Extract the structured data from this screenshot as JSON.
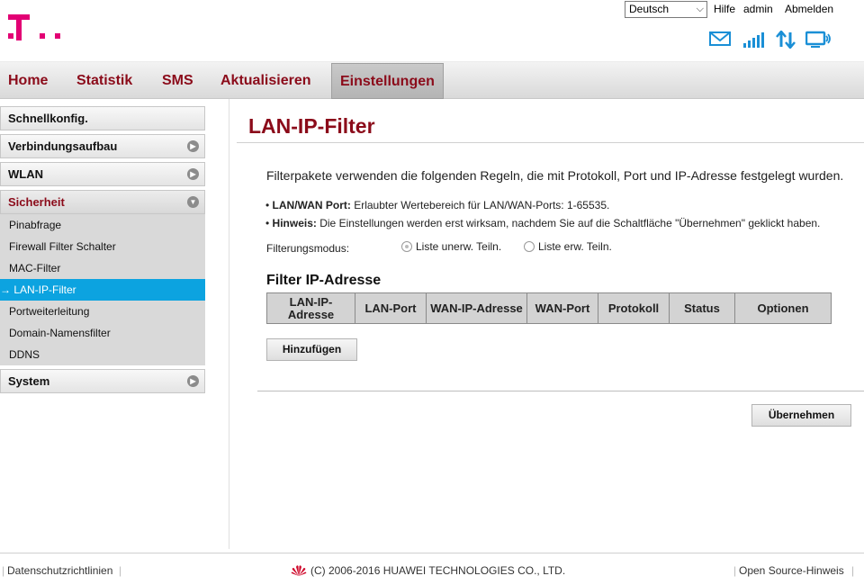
{
  "header": {
    "language": "Deutsch",
    "links": {
      "help": "Hilfe",
      "admin": "admin",
      "logout": "Abmelden"
    },
    "brand_color": "#e20074"
  },
  "nav": {
    "items": [
      {
        "label": "Home"
      },
      {
        "label": "Statistik"
      },
      {
        "label": "SMS"
      },
      {
        "label": "Aktualisieren"
      },
      {
        "label": "Einstellungen",
        "active": true
      }
    ],
    "accent_color": "#8b0b1a"
  },
  "sidebar": {
    "groups": [
      {
        "label": "Schnellkonfig."
      },
      {
        "label": "Verbindungsaufbau"
      },
      {
        "label": "WLAN"
      },
      {
        "label": "Sicherheit",
        "open": true
      },
      {
        "label": "System"
      }
    ],
    "sub_items": [
      {
        "label": "Pinabfrage"
      },
      {
        "label": "Firewall Filter Schalter"
      },
      {
        "label": "MAC-Filter"
      },
      {
        "label": "→ LAN-IP-Filter",
        "active": true
      },
      {
        "label": "Portweiterleitung"
      },
      {
        "label": "Domain-Namensfilter"
      },
      {
        "label": "DDNS"
      }
    ]
  },
  "main": {
    "title": "LAN-IP-Filter",
    "intro": "Filterpakete verwenden die folgenden Regeln, die mit Protokoll, Port und IP-Adresse festgelegt wurden.",
    "bullets": [
      {
        "label": "LAN/WAN Port:",
        "text": " Erlaubter Wertebereich für LAN/WAN-Ports: 1-65535."
      },
      {
        "label": "Hinweis:",
        "text": " Die Einstellungen werden erst wirksam, nachdem Sie auf die Schaltfläche \"Übernehmen\" geklickt haben."
      }
    ],
    "filter_mode_label": "Filterungsmodus:",
    "filter_modes": [
      {
        "label": "Liste unerw. Teiln.",
        "selected": true
      },
      {
        "label": "Liste erw. Teiln.",
        "selected": false
      }
    ],
    "table_title": "Filter IP-Adresse",
    "table_headers": [
      "LAN-IP-Adresse",
      "LAN-Port",
      "WAN-IP-Adresse",
      "WAN-Port",
      "Protokoll",
      "Status",
      "Optionen"
    ],
    "add_button": "Hinzufügen",
    "apply_button": "Übernehmen"
  },
  "footer": {
    "privacy": "Datenschutzrichtlinien",
    "copyright": "(C) 2006-2016 HUAWEI TECHNOLOGIES CO., LTD.",
    "open_source": "Open Source-Hinweis"
  }
}
